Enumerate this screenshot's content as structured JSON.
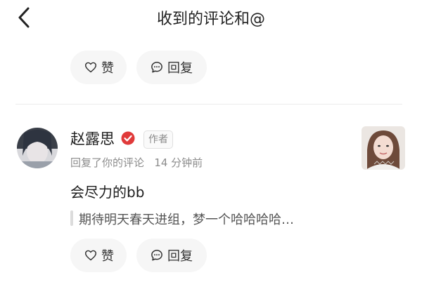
{
  "header": {
    "title": "收到的评论和@",
    "back_icon": "chevron-left-icon"
  },
  "previous_item_actions": {
    "like_label": "赞",
    "reply_label": "回复"
  },
  "comment": {
    "username": "赵露思",
    "verified": true,
    "verified_color": "#e03a3a",
    "author_tag": "作者",
    "action_text": "回复了你的评论",
    "time_ago": "14 分钟前",
    "text": "会尽力的bb",
    "quoted_text": "期待明天春天进组，梦一个哈哈哈哈…",
    "actions": {
      "like_label": "赞",
      "reply_label": "回复"
    }
  }
}
